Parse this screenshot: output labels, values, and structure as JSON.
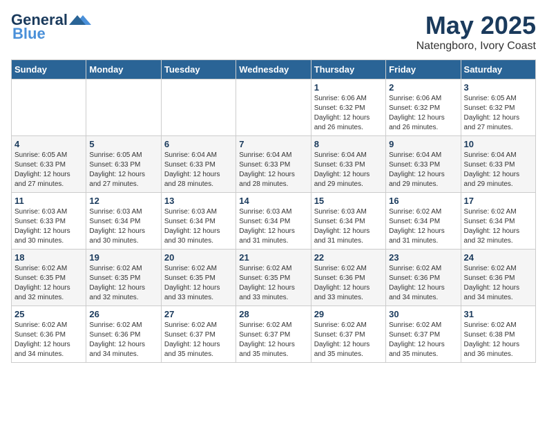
{
  "header": {
    "logo_line1": "General",
    "logo_line2": "Blue",
    "month_year": "May 2025",
    "location": "Natengboro, Ivory Coast"
  },
  "weekdays": [
    "Sunday",
    "Monday",
    "Tuesday",
    "Wednesday",
    "Thursday",
    "Friday",
    "Saturday"
  ],
  "weeks": [
    [
      {
        "day": "",
        "info": ""
      },
      {
        "day": "",
        "info": ""
      },
      {
        "day": "",
        "info": ""
      },
      {
        "day": "",
        "info": ""
      },
      {
        "day": "1",
        "info": "Sunrise: 6:06 AM\nSunset: 6:32 PM\nDaylight: 12 hours\nand 26 minutes."
      },
      {
        "day": "2",
        "info": "Sunrise: 6:06 AM\nSunset: 6:32 PM\nDaylight: 12 hours\nand 26 minutes."
      },
      {
        "day": "3",
        "info": "Sunrise: 6:05 AM\nSunset: 6:32 PM\nDaylight: 12 hours\nand 27 minutes."
      }
    ],
    [
      {
        "day": "4",
        "info": "Sunrise: 6:05 AM\nSunset: 6:33 PM\nDaylight: 12 hours\nand 27 minutes."
      },
      {
        "day": "5",
        "info": "Sunrise: 6:05 AM\nSunset: 6:33 PM\nDaylight: 12 hours\nand 27 minutes."
      },
      {
        "day": "6",
        "info": "Sunrise: 6:04 AM\nSunset: 6:33 PM\nDaylight: 12 hours\nand 28 minutes."
      },
      {
        "day": "7",
        "info": "Sunrise: 6:04 AM\nSunset: 6:33 PM\nDaylight: 12 hours\nand 28 minutes."
      },
      {
        "day": "8",
        "info": "Sunrise: 6:04 AM\nSunset: 6:33 PM\nDaylight: 12 hours\nand 29 minutes."
      },
      {
        "day": "9",
        "info": "Sunrise: 6:04 AM\nSunset: 6:33 PM\nDaylight: 12 hours\nand 29 minutes."
      },
      {
        "day": "10",
        "info": "Sunrise: 6:04 AM\nSunset: 6:33 PM\nDaylight: 12 hours\nand 29 minutes."
      }
    ],
    [
      {
        "day": "11",
        "info": "Sunrise: 6:03 AM\nSunset: 6:33 PM\nDaylight: 12 hours\nand 30 minutes."
      },
      {
        "day": "12",
        "info": "Sunrise: 6:03 AM\nSunset: 6:34 PM\nDaylight: 12 hours\nand 30 minutes."
      },
      {
        "day": "13",
        "info": "Sunrise: 6:03 AM\nSunset: 6:34 PM\nDaylight: 12 hours\nand 30 minutes."
      },
      {
        "day": "14",
        "info": "Sunrise: 6:03 AM\nSunset: 6:34 PM\nDaylight: 12 hours\nand 31 minutes."
      },
      {
        "day": "15",
        "info": "Sunrise: 6:03 AM\nSunset: 6:34 PM\nDaylight: 12 hours\nand 31 minutes."
      },
      {
        "day": "16",
        "info": "Sunrise: 6:02 AM\nSunset: 6:34 PM\nDaylight: 12 hours\nand 31 minutes."
      },
      {
        "day": "17",
        "info": "Sunrise: 6:02 AM\nSunset: 6:34 PM\nDaylight: 12 hours\nand 32 minutes."
      }
    ],
    [
      {
        "day": "18",
        "info": "Sunrise: 6:02 AM\nSunset: 6:35 PM\nDaylight: 12 hours\nand 32 minutes."
      },
      {
        "day": "19",
        "info": "Sunrise: 6:02 AM\nSunset: 6:35 PM\nDaylight: 12 hours\nand 32 minutes."
      },
      {
        "day": "20",
        "info": "Sunrise: 6:02 AM\nSunset: 6:35 PM\nDaylight: 12 hours\nand 33 minutes."
      },
      {
        "day": "21",
        "info": "Sunrise: 6:02 AM\nSunset: 6:35 PM\nDaylight: 12 hours\nand 33 minutes."
      },
      {
        "day": "22",
        "info": "Sunrise: 6:02 AM\nSunset: 6:36 PM\nDaylight: 12 hours\nand 33 minutes."
      },
      {
        "day": "23",
        "info": "Sunrise: 6:02 AM\nSunset: 6:36 PM\nDaylight: 12 hours\nand 34 minutes."
      },
      {
        "day": "24",
        "info": "Sunrise: 6:02 AM\nSunset: 6:36 PM\nDaylight: 12 hours\nand 34 minutes."
      }
    ],
    [
      {
        "day": "25",
        "info": "Sunrise: 6:02 AM\nSunset: 6:36 PM\nDaylight: 12 hours\nand 34 minutes."
      },
      {
        "day": "26",
        "info": "Sunrise: 6:02 AM\nSunset: 6:36 PM\nDaylight: 12 hours\nand 34 minutes."
      },
      {
        "day": "27",
        "info": "Sunrise: 6:02 AM\nSunset: 6:37 PM\nDaylight: 12 hours\nand 35 minutes."
      },
      {
        "day": "28",
        "info": "Sunrise: 6:02 AM\nSunset: 6:37 PM\nDaylight: 12 hours\nand 35 minutes."
      },
      {
        "day": "29",
        "info": "Sunrise: 6:02 AM\nSunset: 6:37 PM\nDaylight: 12 hours\nand 35 minutes."
      },
      {
        "day": "30",
        "info": "Sunrise: 6:02 AM\nSunset: 6:37 PM\nDaylight: 12 hours\nand 35 minutes."
      },
      {
        "day": "31",
        "info": "Sunrise: 6:02 AM\nSunset: 6:38 PM\nDaylight: 12 hours\nand 36 minutes."
      }
    ]
  ]
}
